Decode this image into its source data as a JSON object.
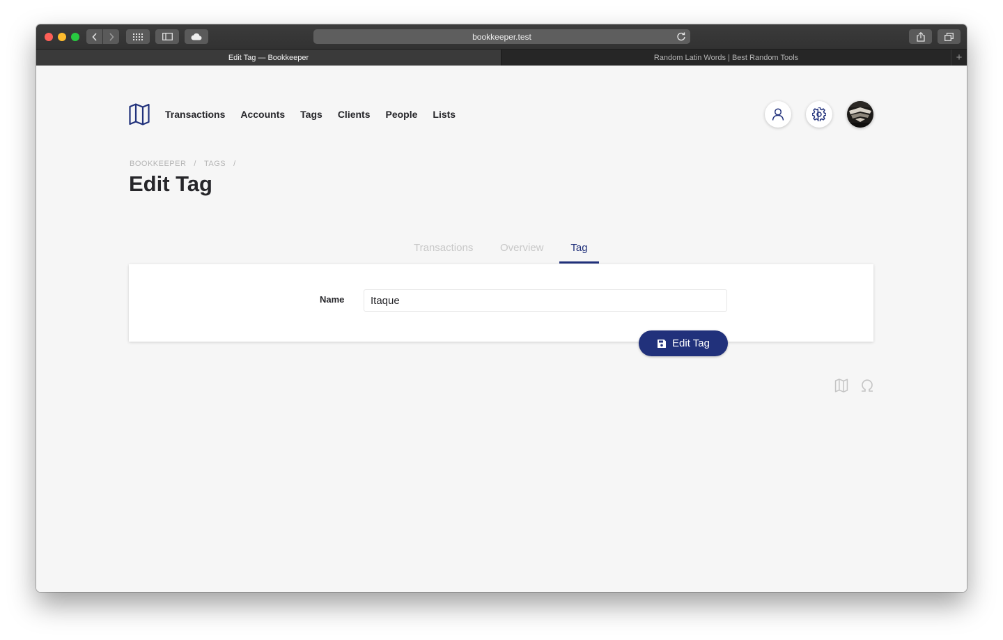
{
  "browser": {
    "url": "bookkeeper.test",
    "tabs": [
      {
        "title": "Edit Tag — Bookkeeper"
      },
      {
        "title": "Random Latin Words | Best Random Tools"
      }
    ],
    "new_tab_glyph": "+"
  },
  "nav": {
    "logo_icon": "folded-map-icon",
    "links": [
      {
        "label": "Transactions"
      },
      {
        "label": "Accounts"
      },
      {
        "label": "Tags"
      },
      {
        "label": "Clients"
      },
      {
        "label": "People"
      },
      {
        "label": "Lists"
      }
    ],
    "actions": {
      "profile_icon": "user-icon",
      "settings_icon": "gear-icon",
      "avatar": "user-avatar"
    }
  },
  "breadcrumb": {
    "items": [
      "BOOKKEEPER",
      "TAGS"
    ],
    "separator": "/"
  },
  "page": {
    "title": "Edit Tag"
  },
  "content_tabs": [
    {
      "label": "Transactions",
      "active": false
    },
    {
      "label": "Overview",
      "active": false
    },
    {
      "label": "Tag",
      "active": true
    }
  ],
  "form": {
    "name_label": "Name",
    "name_value": "Itaque",
    "submit_label": "Edit Tag",
    "submit_icon": "save-icon"
  },
  "footer": {
    "icons": [
      "map-icon",
      "omega-icon"
    ]
  },
  "colors": {
    "accent": "#21317b",
    "background": "#f6f6f6",
    "text": "#26262a",
    "muted": "#b4b4b4"
  }
}
